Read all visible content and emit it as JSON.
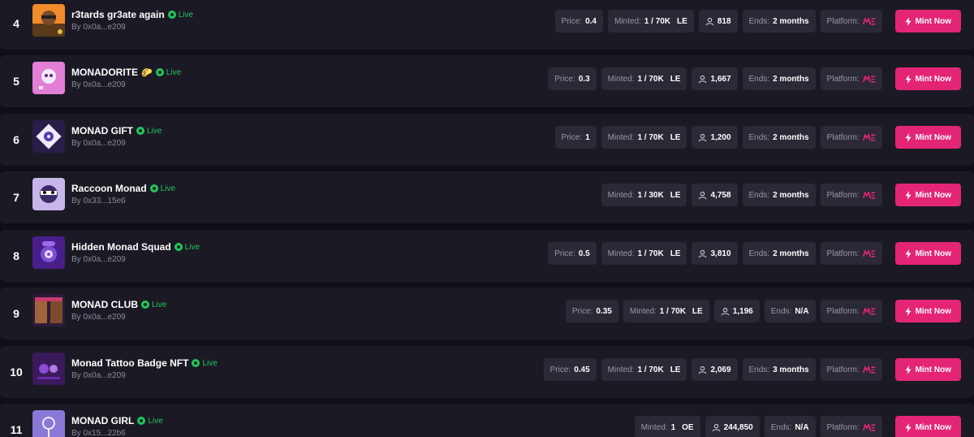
{
  "labels": {
    "price": "Price:",
    "minted": "Minted:",
    "ends": "Ends:",
    "platform": "Platform:",
    "mint_button": "Mint Now",
    "live": "Live"
  },
  "colors": {
    "accent": "#e42575",
    "live": "#22c55e",
    "row_bg": "#1b1a24",
    "pill_bg": "#2a2935",
    "page_bg": "#100f16"
  },
  "icons": {
    "holders": "user-icon",
    "platform": "magic-eden-logo-icon",
    "mint": "lightning-bolt-icon",
    "live": "live-dot-icon"
  },
  "rows": [
    {
      "rank": "4",
      "name": "r3tards gr3ate again",
      "emoji": "",
      "creator": "By 0x0a...e209",
      "price": "0.4",
      "minted": "1 / 70K",
      "edition": "LE",
      "holders": "818",
      "ends": "2 months",
      "thumb": "sunset-ape"
    },
    {
      "rank": "5",
      "name": "MONADORITE",
      "emoji": "🌮",
      "creator": "By 0x0a...e209",
      "price": "0.3",
      "minted": "1 / 70K",
      "edition": "LE",
      "holders": "1,667",
      "ends": "2 months",
      "thumb": "pink-monster"
    },
    {
      "rank": "6",
      "name": "MONAD GIFT",
      "emoji": "",
      "creator": "By 0x0a...e209",
      "price": "1",
      "minted": "1 / 70K",
      "edition": "LE",
      "holders": "1,200",
      "ends": "2 months",
      "thumb": "purple-diamond"
    },
    {
      "rank": "7",
      "name": "Raccoon Monad",
      "emoji": "",
      "creator": "By 0x33...15e6",
      "price": null,
      "minted": "1 / 30K",
      "edition": "LE",
      "holders": "4,758",
      "ends": "2 months",
      "thumb": "raccoon"
    },
    {
      "rank": "8",
      "name": "Hidden Monad Squad",
      "emoji": "",
      "creator": "By 0x0a...e209",
      "price": "0.5",
      "minted": "1 / 70K",
      "edition": "LE",
      "holders": "3,810",
      "ends": "2 months",
      "thumb": "hidden-squad"
    },
    {
      "rank": "9",
      "name": "MONAD CLUB",
      "emoji": "",
      "creator": "By 0x0a...e209",
      "price": "0.35",
      "minted": "1 / 70K",
      "edition": "LE",
      "holders": "1,196",
      "ends": "N/A",
      "thumb": "club"
    },
    {
      "rank": "10",
      "name": "Monad Tattoo Badge NFT",
      "emoji": "",
      "creator": "By 0x0a...e209",
      "price": "0.45",
      "minted": "1 / 70K",
      "edition": "LE",
      "holders": "2,069",
      "ends": "3 months",
      "thumb": "tattoo"
    },
    {
      "rank": "11",
      "name": "MONAD GIRL",
      "emoji": "",
      "creator": "By 0x15...22b6",
      "price": null,
      "minted": "1",
      "edition": "OE",
      "holders": "244,850",
      "ends": "N/A",
      "thumb": "girl"
    }
  ]
}
